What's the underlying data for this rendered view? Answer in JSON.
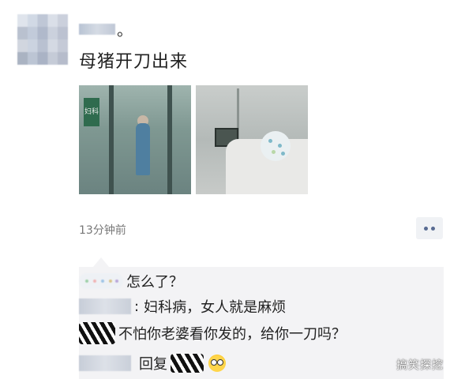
{
  "post": {
    "nickname_suffix": "。",
    "text": "母猪开刀出来",
    "time": "13分钟前"
  },
  "photos": [
    {
      "name": "hospital-corridor-photo",
      "sign": "妇科"
    },
    {
      "name": "hospital-ward-photo"
    }
  ],
  "comments": [
    {
      "text": "怎么了？"
    },
    {
      "sep": ":",
      "text": "妇科病，女人就是麻烦"
    },
    {
      "text": "不怕你老婆看你发的，给你一刀吗？"
    },
    {
      "reply_label": "回复",
      "emoji": "flushed-emoji"
    }
  ],
  "icons": {
    "more": "more-dots-icon"
  },
  "watermark": "搞笑探挖",
  "colors": {
    "comment_bg": "#f3f3f5",
    "link_blue": "#586b92"
  }
}
